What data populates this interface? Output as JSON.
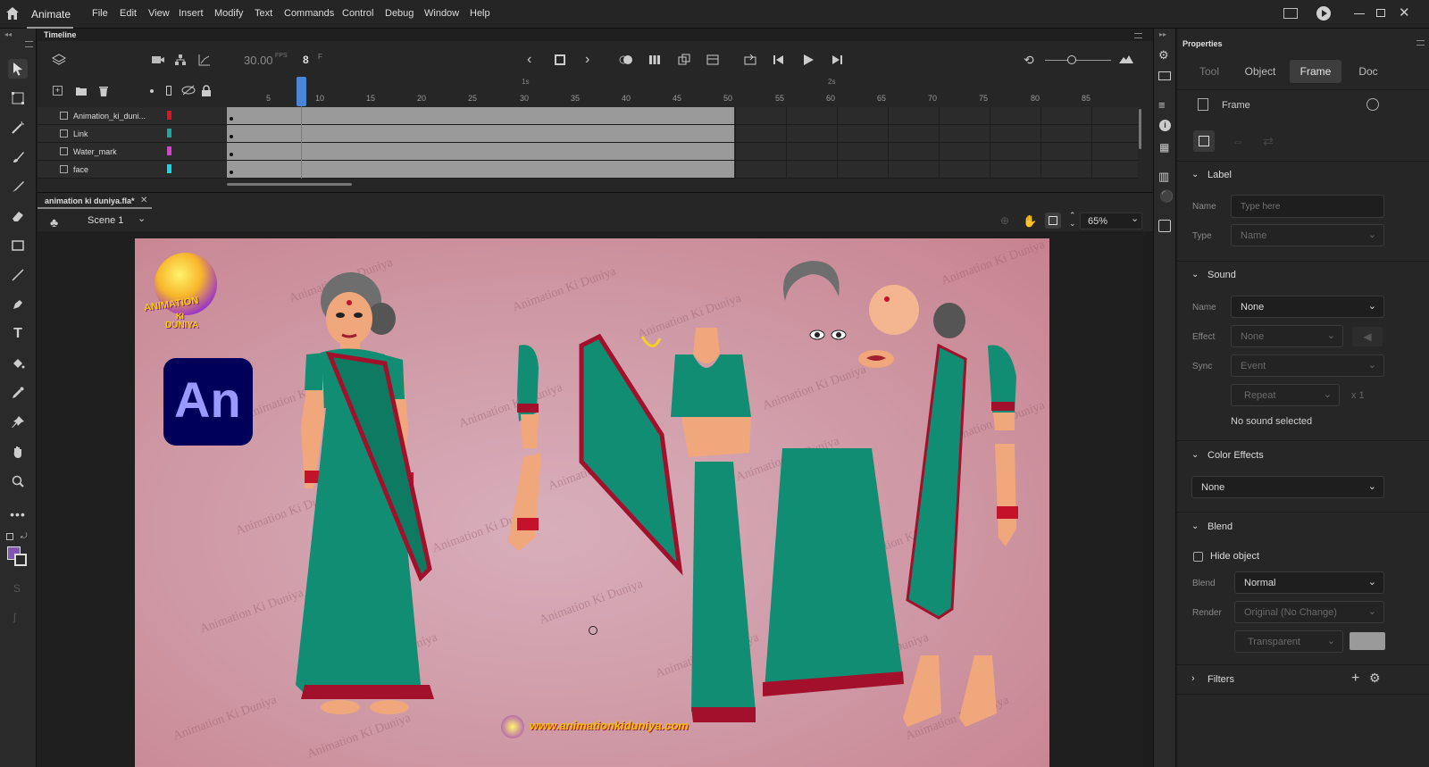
{
  "app": {
    "name": "Animate"
  },
  "menu": [
    "File",
    "Edit",
    "View",
    "Insert",
    "Modify",
    "Text",
    "Commands",
    "Control",
    "Debug",
    "Window",
    "Help"
  ],
  "timeline": {
    "panel_title": "Timeline",
    "fps": "30.00",
    "fps_unit": "FPS",
    "current_frame": "8",
    "frame_unit": "F",
    "ruler": [
      "5",
      "10",
      "15",
      "20",
      "25",
      "30",
      "35",
      "40",
      "45",
      "50",
      "55",
      "60",
      "65",
      "70",
      "75",
      "80",
      "85"
    ],
    "seconds": [
      "1s",
      "2s"
    ],
    "layers": [
      {
        "name": "Animation_ki_duni...",
        "color": "#e0141e"
      },
      {
        "name": "Link",
        "color": "#1aa9a0"
      },
      {
        "name": "Water_mark",
        "color": "#e23ad6"
      },
      {
        "name": "face",
        "color": "#12d8e8"
      }
    ]
  },
  "document": {
    "tab_name": "animation ki duniya.fla*",
    "scene": "Scene 1",
    "zoom": "65%"
  },
  "stage": {
    "an_logo": "An",
    "watermark": "Animation Ki Duniya",
    "logo_lines": [
      "ANIMATION",
      "KI",
      "DUNIYA"
    ],
    "url": "www.animationkiduniya.com"
  },
  "properties": {
    "panel_title": "Properties",
    "tabs": [
      "Tool",
      "Object",
      "Frame",
      "Doc"
    ],
    "active_tab": "Frame",
    "header": "Frame",
    "label_section": {
      "title": "Label",
      "name_label": "Name",
      "name_placeholder": "Type here",
      "type_label": "Type",
      "type_value": "Name"
    },
    "sound_section": {
      "title": "Sound",
      "name_label": "Name",
      "name_value": "None",
      "effect_label": "Effect",
      "effect_value": "None",
      "sync_label": "Sync",
      "sync_value": "Event",
      "repeat_value": "Repeat",
      "repeat_count": "x 1",
      "status": "No sound selected"
    },
    "color_effects": {
      "title": "Color Effects",
      "value": "None"
    },
    "blend_section": {
      "title": "Blend",
      "hide_object": "Hide object",
      "blend_label": "Blend",
      "blend_value": "Normal",
      "render_label": "Render",
      "render_value": "Original (No Change)",
      "bg_value": "Transparent"
    },
    "filters": {
      "title": "Filters"
    }
  }
}
